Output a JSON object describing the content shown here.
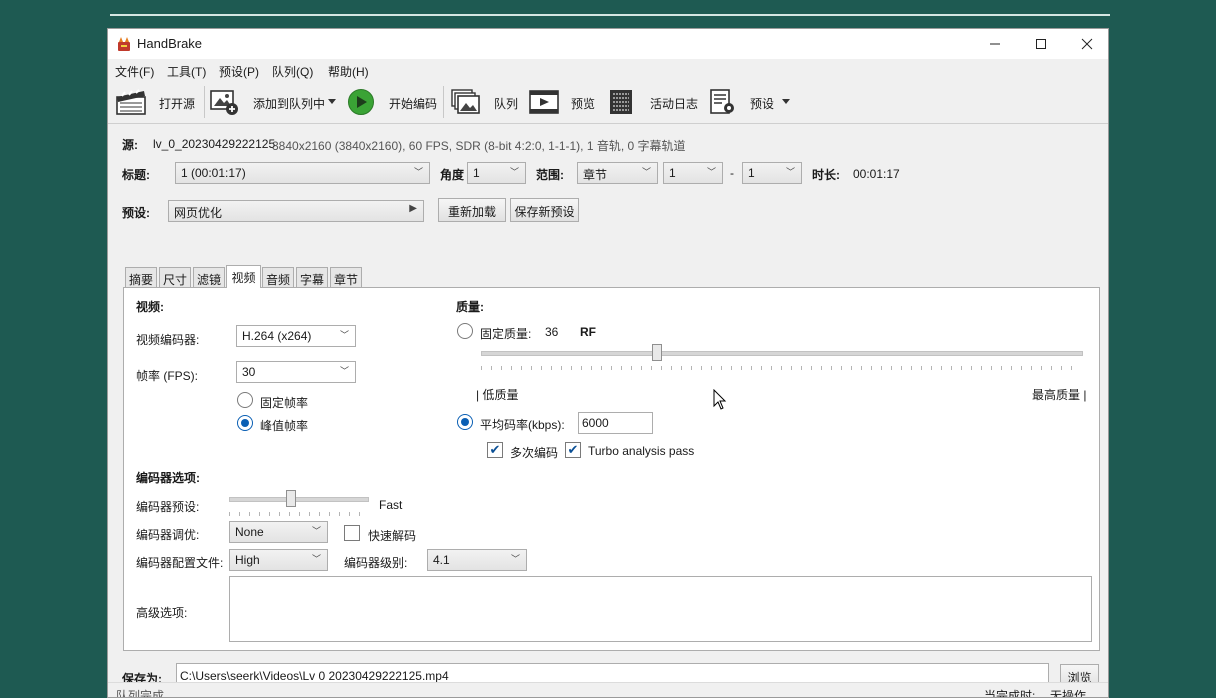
{
  "window": {
    "title": "HandBrake",
    "controls": {
      "minimize": "—",
      "maximize": "☐",
      "close": "✕"
    }
  },
  "menu": [
    "文件(F)",
    "工具(T)",
    "预设(P)",
    "队列(Q)",
    "帮助(H)"
  ],
  "toolbar": {
    "open_source": "打开源",
    "add_to_queue": "添加到队列中",
    "start_encode": "开始编码",
    "queue": "队列",
    "preview": "预览",
    "activity_log": "活动日志",
    "presets": "预设"
  },
  "source": {
    "label": "源:",
    "name": "lv_0_20230429222125",
    "info": "3840x2160 (3840x2160), 60 FPS, SDR (8-bit 4:2:0, 1-1-1), 1 音轨, 0 字幕轨道"
  },
  "title_row": {
    "title_label": "标题:",
    "title_value": "1  (00:01:17)",
    "angle_label": "角度",
    "angle_value": "1",
    "range_label": "范围:",
    "range_type": "章节",
    "range_start": "1",
    "range_dash": "-",
    "range_end": "1",
    "duration_label": "时长:",
    "duration_value": "00:01:17"
  },
  "preset_row": {
    "label": "预设:",
    "value": "网页优化",
    "reload_button": "重新加载",
    "save_new_button": "保存新预设"
  },
  "tabs": [
    "摘要",
    "尺寸",
    "滤镜",
    "视频",
    "音频",
    "字幕",
    "章节"
  ],
  "active_tab": "视频",
  "video": {
    "section_label": "视频:",
    "encoder_label": "视频编码器:",
    "encoder_value": "H.264 (x264)",
    "fps_label": "帧率 (FPS):",
    "fps_value": "30",
    "constant_fps": "固定帧率",
    "peak_fps": "峰值帧率",
    "peak_fps_selected": true
  },
  "quality": {
    "section_label": "质量:",
    "constant_quality_label": "固定质量:",
    "rf_value": "36",
    "rf_unit": "RF",
    "slider_level": 0.29,
    "low_label": "| 低质量",
    "high_label": "最高质量 |",
    "avg_bitrate_label": "平均码率(kbps):",
    "avg_bitrate_value": "6000",
    "avg_bitrate_selected": true,
    "multipass_label": "多次编码",
    "multipass_checked": true,
    "turbo_label": "Turbo analysis pass",
    "turbo_checked": true
  },
  "encoder_options": {
    "section_label": "编码器选项:",
    "preset_label": "编码器预设:",
    "preset_value": "Fast",
    "preset_slider_level": 0.44,
    "tune_label": "编码器调优:",
    "tune_value": "None",
    "fast_decode_label": "快速解码",
    "fast_decode_checked": false,
    "profile_label": "编码器配置文件:",
    "profile_value": "High",
    "level_label": "编码器级别:",
    "level_value": "4.1",
    "advanced_label": "高级选项:",
    "advanced_value": ""
  },
  "save_as": {
    "label": "保存为:",
    "path": "C:\\Users\\seerk\\Videos\\Lv 0 20230429222125.mp4",
    "browse_button": "浏览"
  },
  "status": {
    "left": "队列完成",
    "right_label": "当完成时:",
    "right_value": "无操作"
  }
}
